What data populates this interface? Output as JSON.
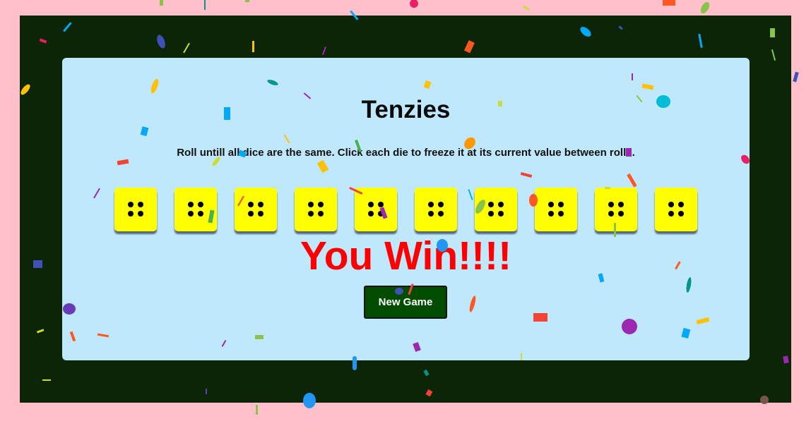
{
  "app": {
    "title": "Tenzies",
    "instructions": "Roll untill all dice are the same. Click each die to freeze it at its current value between rolls.",
    "win_message": "You Win!!!!",
    "new_game_label": "New Game"
  },
  "dice": [
    {
      "value": 4,
      "held": false
    },
    {
      "value": 4,
      "held": false
    },
    {
      "value": 4,
      "held": false
    },
    {
      "value": 4,
      "held": false
    },
    {
      "value": 4,
      "held": false
    },
    {
      "value": 4,
      "held": false
    },
    {
      "value": 4,
      "held": false
    },
    {
      "value": 4,
      "held": false
    },
    {
      "value": 4,
      "held": false
    },
    {
      "value": 4,
      "held": false
    }
  ],
  "colors": {
    "page_background": "#ffc0cb",
    "frame_background": "#0b2506",
    "card_background": "#c0e8fc",
    "die_face": "#ffff00",
    "win_text": "#ff0000",
    "button_background": "#034d03",
    "confetti": [
      "#f44336",
      "#e91e63",
      "#9c27b0",
      "#673ab7",
      "#3f51b5",
      "#2196f3",
      "#03a9f4",
      "#00bcd4",
      "#009688",
      "#4caf50",
      "#8bc34a",
      "#cddc39",
      "#ffeb3b",
      "#ffc107",
      "#ff9800",
      "#ff5722",
      "#795548"
    ]
  }
}
